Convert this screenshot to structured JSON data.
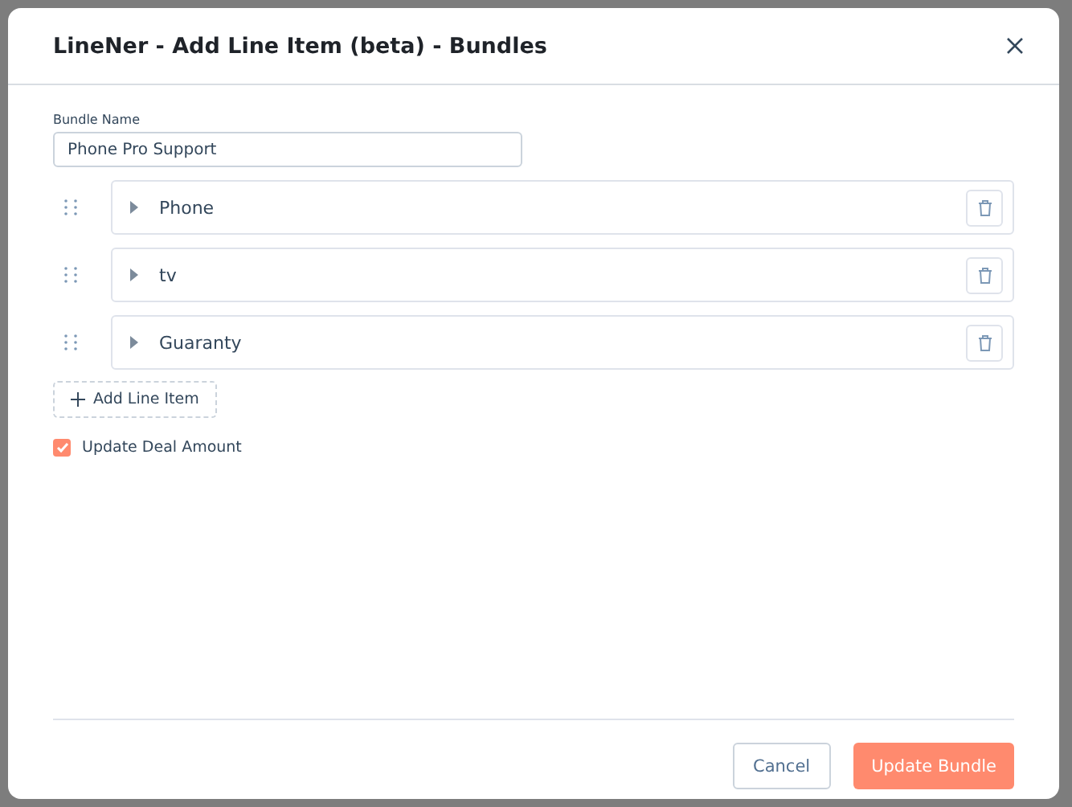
{
  "dialog": {
    "title": "LineNer - Add Line Item (beta) - Bundles"
  },
  "bundle_name": {
    "label": "Bundle Name",
    "value": "Phone Pro Support"
  },
  "line_items": [
    {
      "name": "Phone",
      "expanded": false
    },
    {
      "name": "tv",
      "expanded": false
    },
    {
      "name": "Guaranty",
      "expanded": false
    }
  ],
  "add_button": "Add Line Item",
  "update_deal_amount": {
    "label": "Update Deal Amount",
    "checked": true
  },
  "buttons": {
    "cancel": "Cancel",
    "submit": "Update Bundle"
  }
}
